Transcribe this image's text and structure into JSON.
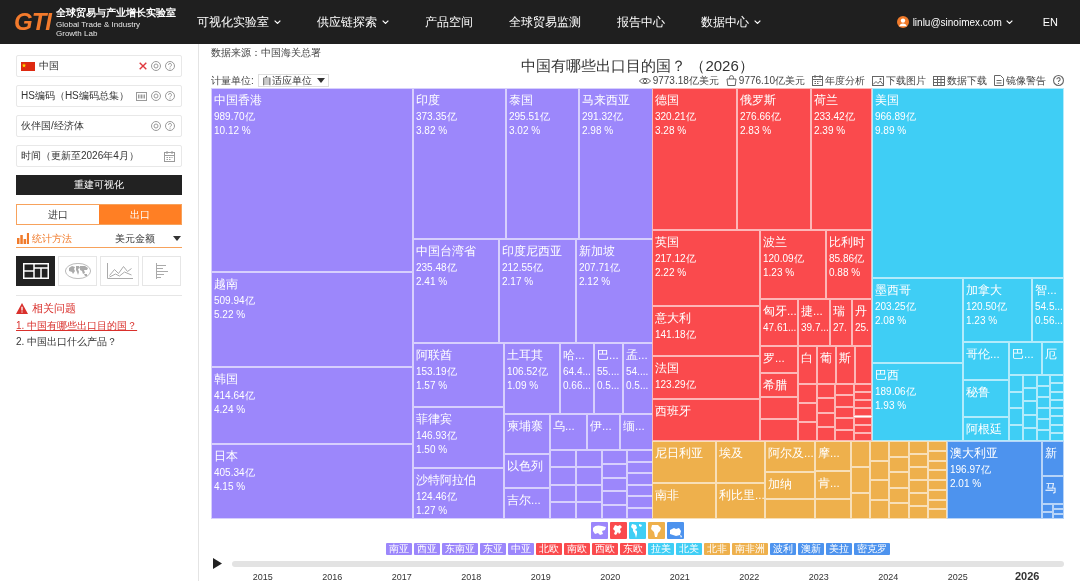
{
  "topbar": {
    "logo": {
      "mark": "GTI",
      "title": "全球贸易与产业增长实验室",
      "subtitle": "Global Trade & Industry Growth Lab"
    },
    "menu": [
      {
        "label": "可视化实验室",
        "dropdown": true
      },
      {
        "label": "供应链探索",
        "dropdown": true
      },
      {
        "label": "产品空间",
        "dropdown": false
      },
      {
        "label": "全球贸易监测",
        "dropdown": false
      },
      {
        "label": "报告中心",
        "dropdown": false
      },
      {
        "label": "数据中心",
        "dropdown": true
      }
    ],
    "account": {
      "email": "linlu@sinoimex.com"
    },
    "language": "EN"
  },
  "sidebar": {
    "fields": [
      {
        "kind": "country",
        "value": "中国"
      },
      {
        "kind": "code",
        "value": "HS编码（HS编码总集）"
      },
      {
        "kind": "partner",
        "value": "伙伴国/经济体"
      },
      {
        "kind": "date",
        "value": "时间（更新至2026年4月）"
      }
    ],
    "rebuild_button": "重建可视化",
    "direction_tabs": [
      {
        "label": "进口",
        "selected": false
      },
      {
        "label": "出口",
        "selected": true
      }
    ],
    "stat_method": {
      "label": "统计方法",
      "value": "美元金额"
    },
    "view_buttons": [
      {
        "kind": "treemap",
        "selected": true
      },
      {
        "kind": "map",
        "selected": false
      },
      {
        "kind": "line",
        "selected": false
      },
      {
        "kind": "bar",
        "selected": false
      }
    ],
    "related": {
      "title": "相关问题",
      "questions": [
        {
          "text": "1. 中国有哪些出口目的国？",
          "selected": true
        },
        {
          "text": "2. 中国出口什么产品？",
          "selected": false
        }
      ]
    }
  },
  "chart_panel": {
    "source": "数据来源：中国海关总署",
    "title": "中国有哪些出口目的国？ （2026）",
    "unit": {
      "label": "计量单位:",
      "value": "自适应单位"
    },
    "toolbar": [
      {
        "kind": "eye",
        "label": "9773.18亿美元"
      },
      {
        "kind": "bag",
        "label": "9776.10亿美元"
      },
      {
        "kind": "calendar",
        "label": "年度分析"
      },
      {
        "kind": "image",
        "label": "下载图片"
      },
      {
        "kind": "table",
        "label": "数据下载"
      },
      {
        "kind": "document",
        "label": "镜像警告"
      },
      {
        "kind": "help"
      }
    ],
    "treemap": {
      "regions": [
        {
          "color": "#9c87fb",
          "cells": [
            {
              "name": "中国香港",
              "value": "989.70亿",
              "share": "10.12 %"
            },
            {
              "name": "越南",
              "value": "509.94亿",
              "share": "5.22 %"
            },
            {
              "name": "韩国",
              "value": "414.64亿",
              "share": "4.24 %"
            },
            {
              "name": "日本",
              "value": "405.34亿",
              "share": "4.15 %"
            },
            {
              "name": "印度",
              "value": "373.35亿",
              "share": "3.82 %"
            },
            {
              "name": "泰国",
              "value": "295.51亿",
              "share": "3.02 %"
            },
            {
              "name": "马来西亚",
              "value": "291.32亿",
              "share": "2.98 %"
            },
            {
              "name": "中国台湾省",
              "value": "235.48亿",
              "share": "2.41 %"
            },
            {
              "name": "印度尼西亚",
              "value": "212.55亿",
              "share": "2.17 %"
            },
            {
              "name": "新加坡",
              "value": "207.71亿",
              "share": "2.12 %"
            },
            {
              "name": "阿联酋",
              "value": "153.19亿",
              "share": "1.57 %"
            },
            {
              "name": "菲律宾",
              "value": "146.93亿",
              "share": "1.50 %"
            },
            {
              "name": "沙特阿拉伯",
              "value": "124.46亿",
              "share": "1.27 %"
            },
            {
              "name": "土耳其",
              "value": "106.52亿",
              "share": "1.09 %"
            },
            {
              "name": "哈...",
              "value": "64.4...",
              "share": "0.66..."
            },
            {
              "name": "巴...",
              "value": "55....",
              "share": "0.5..."
            },
            {
              "name": "孟...",
              "value": "54....",
              "share": "0.5..."
            },
            {
              "name": "柬埔寨"
            },
            {
              "name": "乌..."
            },
            {
              "name": "伊..."
            },
            {
              "name": "缅..."
            },
            {
              "name": "以色列"
            },
            {
              "name": "吉尔..."
            }
          ]
        },
        {
          "color": "#fa4a4d",
          "cells": [
            {
              "name": "德国",
              "value": "320.21亿",
              "share": "3.28 %"
            },
            {
              "name": "俄罗斯",
              "value": "276.66亿",
              "share": "2.83 %"
            },
            {
              "name": "荷兰",
              "value": "233.42亿",
              "share": "2.39 %"
            },
            {
              "name": "英国",
              "value": "217.12亿",
              "share": "2.22 %"
            },
            {
              "name": "波兰",
              "value": "120.09亿",
              "share": "1.23 %"
            },
            {
              "name": "比利时",
              "value": "85.86亿",
              "share": "0.88 %"
            },
            {
              "name": "意大利",
              "value": "141.18亿"
            },
            {
              "name": "法国",
              "value": "123.29亿"
            },
            {
              "name": "西班牙"
            },
            {
              "name": "匈牙...",
              "value": "47.61..."
            },
            {
              "name": "捷...",
              "value": "39.7..."
            },
            {
              "name": "瑞",
              "value": "27."
            },
            {
              "name": "丹",
              "value": "25."
            },
            {
              "name": "罗..."
            },
            {
              "name": "希腊"
            },
            {
              "name": "白"
            },
            {
              "name": "葡"
            },
            {
              "name": "斯"
            }
          ]
        },
        {
          "color": "#3fcef5",
          "cells": [
            {
              "name": "美国",
              "value": "966.89亿",
              "share": "9.89 %"
            },
            {
              "name": "墨西哥",
              "value": "203.25亿",
              "share": "2.08 %"
            },
            {
              "name": "巴西",
              "value": "189.06亿",
              "share": "1.93 %"
            },
            {
              "name": "加拿大",
              "value": "120.50亿",
              "share": "1.23 %"
            },
            {
              "name": "智...",
              "value": "54.5...",
              "share": "0.56..."
            },
            {
              "name": "哥伦..."
            },
            {
              "name": "巴..."
            },
            {
              "name": "厄"
            },
            {
              "name": "秘鲁"
            },
            {
              "name": "阿根廷"
            }
          ]
        },
        {
          "color": "#eeb04c",
          "cells": [
            {
              "name": "尼日利亚"
            },
            {
              "name": "南非"
            },
            {
              "name": "埃及"
            },
            {
              "name": "利比里..."
            },
            {
              "name": "阿尔及..."
            },
            {
              "name": "加纳"
            },
            {
              "name": "摩..."
            },
            {
              "name": "肯..."
            }
          ]
        },
        {
          "color": "#4d93ee",
          "cells": [
            {
              "name": "澳大利亚",
              "value": "196.97亿",
              "share": "2.01 %"
            },
            {
              "name": "新"
            },
            {
              "name": "马"
            }
          ]
        }
      ]
    },
    "legend": {
      "continents": [
        {
          "kind": "asia",
          "color": "#9c87fb"
        },
        {
          "kind": "europe",
          "color": "#fa4a4d"
        },
        {
          "kind": "americas",
          "color": "#3fcef5"
        },
        {
          "kind": "africa",
          "color": "#eeb04c"
        },
        {
          "kind": "oceania",
          "color": "#4d93ee"
        }
      ],
      "tags": [
        {
          "label": "南亚",
          "color": "#9c87fb"
        },
        {
          "label": "西亚",
          "color": "#9c87fb"
        },
        {
          "label": "东南亚",
          "color": "#9c87fb"
        },
        {
          "label": "东亚",
          "color": "#9c87fb"
        },
        {
          "label": "中亚",
          "color": "#9c87fb"
        },
        {
          "label": "北欧",
          "color": "#fa4a4d"
        },
        {
          "label": "南欧",
          "color": "#fa4a4d"
        },
        {
          "label": "西欧",
          "color": "#fa4a4d"
        },
        {
          "label": "东欧",
          "color": "#fa4a4d"
        },
        {
          "label": "拉美",
          "color": "#3fcef5"
        },
        {
          "label": "北美",
          "color": "#3fcef5"
        },
        {
          "label": "北非",
          "color": "#eeb04c"
        },
        {
          "label": "南非洲",
          "color": "#eeb04c"
        },
        {
          "label": "波利",
          "color": "#4d93ee"
        },
        {
          "label": "澳新",
          "color": "#4d93ee"
        },
        {
          "label": "美拉",
          "color": "#4d93ee"
        },
        {
          "label": "密克罗",
          "color": "#4d93ee"
        }
      ]
    },
    "timeline": {
      "years": [
        {
          "label": "2015",
          "selected": false
        },
        {
          "label": "2016",
          "selected": false
        },
        {
          "label": "2017",
          "selected": false
        },
        {
          "label": "2018",
          "selected": false
        },
        {
          "label": "2019",
          "selected": false
        },
        {
          "label": "2020",
          "selected": false
        },
        {
          "label": "2021",
          "selected": false
        },
        {
          "label": "2022",
          "selected": false
        },
        {
          "label": "2023",
          "selected": false
        },
        {
          "label": "2024",
          "selected": false
        },
        {
          "label": "2025",
          "selected": false
        },
        {
          "label": "2026",
          "selected": true
        }
      ]
    }
  }
}
